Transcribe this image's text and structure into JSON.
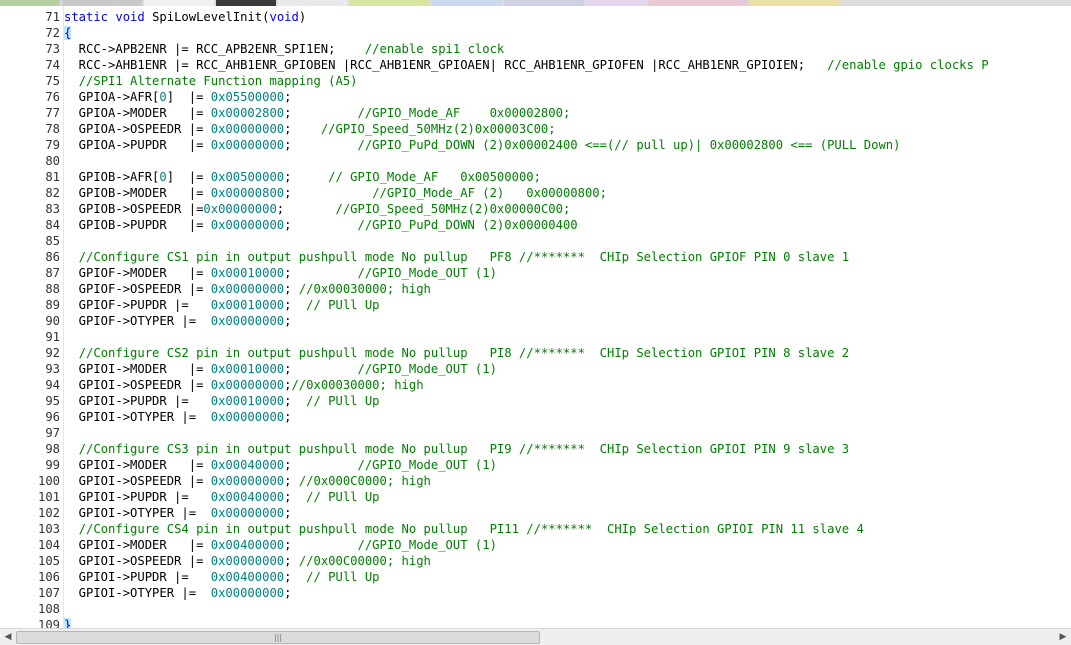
{
  "tab_colors": [
    "#b5d1a2",
    "#c9c9c9",
    "#f0f0f0",
    "#3a3a3a",
    "#e9e9e9",
    "#d6e6a0",
    "#cbd9ef",
    "#cfcfe6",
    "#e6d6f0",
    "#eac9d6",
    "#ebe1a8"
  ],
  "icons": {
    "scroll_left": "left-arrow-icon",
    "scroll_right": "right-arrow-icon",
    "grip": "grip-icon"
  },
  "lines": [
    {
      "n": "71",
      "segs": [
        {
          "t": "static",
          "c": "kw"
        },
        {
          "t": " "
        },
        {
          "t": "void",
          "c": "kw"
        },
        {
          "t": " SpiLowLevelInit("
        },
        {
          "t": "void",
          "c": "kw"
        },
        {
          "t": ")"
        }
      ]
    },
    {
      "n": "72",
      "segs": [
        {
          "t": "{",
          "c": "brace"
        }
      ]
    },
    {
      "n": "73",
      "segs": [
        {
          "t": "  RCC->APB2ENR |= RCC_APB2ENR_SPI1EN;    "
        },
        {
          "t": "//enable spi1 clock",
          "c": "cm"
        }
      ]
    },
    {
      "n": "74",
      "segs": [
        {
          "t": "  RCC->AHB1ENR |= RCC_AHB1ENR_GPIOBEN |RCC_AHB1ENR_GPIOAEN| RCC_AHB1ENR_GPIOFEN |RCC_AHB1ENR_GPIOIEN;   "
        },
        {
          "t": "//enable gpio clocks P",
          "c": "cm"
        }
      ]
    },
    {
      "n": "75",
      "segs": [
        {
          "t": "  "
        },
        {
          "t": "//SPI1 Alternate Function mapping (A5)",
          "c": "cm"
        }
      ]
    },
    {
      "n": "76",
      "segs": [
        {
          "t": "  GPIOA->AFR["
        },
        {
          "t": "0",
          "c": "num"
        },
        {
          "t": "]  |= "
        },
        {
          "t": "0x05500000",
          "c": "num"
        },
        {
          "t": ";"
        }
      ]
    },
    {
      "n": "77",
      "segs": [
        {
          "t": "  GPIOA->MODER   |= "
        },
        {
          "t": "0x00002800",
          "c": "num"
        },
        {
          "t": ";         "
        },
        {
          "t": "//GPIO_Mode_AF    0x00002800;",
          "c": "cm"
        }
      ]
    },
    {
      "n": "78",
      "segs": [
        {
          "t": "  GPIOA->OSPEEDR |= "
        },
        {
          "t": "0x00000000",
          "c": "num"
        },
        {
          "t": ";    "
        },
        {
          "t": "//GPIO_Speed_50MHz(2)0x00003C00;",
          "c": "cm"
        }
      ]
    },
    {
      "n": "79",
      "segs": [
        {
          "t": "  GPIOA->PUPDR   |= "
        },
        {
          "t": "0x00000000",
          "c": "num"
        },
        {
          "t": ";         "
        },
        {
          "t": "//GPIO_PuPd_DOWN (2)0x00002400 <==(// pull up)| 0x00002800 <== (PULL Down)",
          "c": "cm"
        }
      ]
    },
    {
      "n": "80",
      "segs": []
    },
    {
      "n": "81",
      "segs": [
        {
          "t": "  GPIOB->AFR["
        },
        {
          "t": "0",
          "c": "num"
        },
        {
          "t": "]  |= "
        },
        {
          "t": "0x00500000",
          "c": "num"
        },
        {
          "t": ";     "
        },
        {
          "t": "// GPIO_Mode_AF   0x00500000;",
          "c": "cm"
        }
      ]
    },
    {
      "n": "82",
      "segs": [
        {
          "t": "  GPIOB->MODER   |= "
        },
        {
          "t": "0x00000800",
          "c": "num"
        },
        {
          "t": ";           "
        },
        {
          "t": "//GPIO_Mode_AF (2)   0x00000800;",
          "c": "cm"
        }
      ]
    },
    {
      "n": "83",
      "segs": [
        {
          "t": "  GPIOB->OSPEEDR |="
        },
        {
          "t": "0x00000000",
          "c": "num"
        },
        {
          "t": ";       "
        },
        {
          "t": "//GPIO_Speed_50MHz(2)0x00000C00;",
          "c": "cm"
        }
      ]
    },
    {
      "n": "84",
      "segs": [
        {
          "t": "  GPIOB->PUPDR   |= "
        },
        {
          "t": "0x00000000",
          "c": "num"
        },
        {
          "t": ";         "
        },
        {
          "t": "//GPIO_PuPd_DOWN (2)0x00000400",
          "c": "cm"
        }
      ]
    },
    {
      "n": "85",
      "segs": []
    },
    {
      "n": "86",
      "segs": [
        {
          "t": "  "
        },
        {
          "t": "//Configure CS1 pin in output pushpull mode No pullup   PF8 //*******  CHIp Selection GPIOF PIN 0 slave 1",
          "c": "cm"
        }
      ]
    },
    {
      "n": "87",
      "segs": [
        {
          "t": "  GPIOF->MODER   |= "
        },
        {
          "t": "0x00010000",
          "c": "num"
        },
        {
          "t": ";         "
        },
        {
          "t": "//GPIO_Mode_OUT (1)",
          "c": "cm"
        }
      ]
    },
    {
      "n": "88",
      "segs": [
        {
          "t": "  GPIOF->OSPEEDR |= "
        },
        {
          "t": "0x00000000",
          "c": "num"
        },
        {
          "t": "; "
        },
        {
          "t": "//0x00030000; high",
          "c": "cm"
        }
      ]
    },
    {
      "n": "89",
      "segs": [
        {
          "t": "  GPIOF->PUPDR |=   "
        },
        {
          "t": "0x00010000",
          "c": "num"
        },
        {
          "t": ";  "
        },
        {
          "t": "// PUll Up",
          "c": "cm"
        }
      ]
    },
    {
      "n": "90",
      "segs": [
        {
          "t": "  GPIOF->OTYPER |=  "
        },
        {
          "t": "0x00000000",
          "c": "num"
        },
        {
          "t": ";"
        }
      ]
    },
    {
      "n": "91",
      "segs": []
    },
    {
      "n": "92",
      "segs": [
        {
          "t": "  "
        },
        {
          "t": "//Configure CS2 pin in output pushpull mode No pullup   PI8 //*******  CHIp Selection GPIOI PIN 8 slave 2",
          "c": "cm"
        }
      ]
    },
    {
      "n": "93",
      "segs": [
        {
          "t": "  GPIOI->MODER   |= "
        },
        {
          "t": "0x00010000",
          "c": "num"
        },
        {
          "t": ";         "
        },
        {
          "t": "//GPIO_Mode_OUT (1)",
          "c": "cm"
        }
      ]
    },
    {
      "n": "94",
      "segs": [
        {
          "t": "  GPIOI->OSPEEDR |= "
        },
        {
          "t": "0x00000000",
          "c": "num"
        },
        {
          "t": ";"
        },
        {
          "t": "//0x00030000; high",
          "c": "cm"
        }
      ]
    },
    {
      "n": "95",
      "segs": [
        {
          "t": "  GPIOI->PUPDR |=   "
        },
        {
          "t": "0x00010000",
          "c": "num"
        },
        {
          "t": ";  "
        },
        {
          "t": "// PUll Up",
          "c": "cm"
        }
      ]
    },
    {
      "n": "96",
      "segs": [
        {
          "t": "  GPIOI->OTYPER |=  "
        },
        {
          "t": "0x00000000",
          "c": "num"
        },
        {
          "t": ";"
        }
      ]
    },
    {
      "n": "97",
      "segs": []
    },
    {
      "n": "98",
      "segs": [
        {
          "t": "  "
        },
        {
          "t": "//Configure CS3 pin in output pushpull mode No pullup   PI9 //*******  CHIp Selection GPIOI PIN 9 slave 3",
          "c": "cm"
        }
      ]
    },
    {
      "n": "99",
      "segs": [
        {
          "t": "  GPIOI->MODER   |= "
        },
        {
          "t": "0x00040000",
          "c": "num"
        },
        {
          "t": ";         "
        },
        {
          "t": "//GPIO_Mode_OUT (1)",
          "c": "cm"
        }
      ]
    },
    {
      "n": "100",
      "segs": [
        {
          "t": "  GPIOI->OSPEEDR |= "
        },
        {
          "t": "0x00000000",
          "c": "num"
        },
        {
          "t": "; "
        },
        {
          "t": "//0x000C0000; high",
          "c": "cm"
        }
      ]
    },
    {
      "n": "101",
      "segs": [
        {
          "t": "  GPIOI->PUPDR |=   "
        },
        {
          "t": "0x00040000",
          "c": "num"
        },
        {
          "t": ";  "
        },
        {
          "t": "// PUll Up",
          "c": "cm"
        }
      ]
    },
    {
      "n": "102",
      "segs": [
        {
          "t": "  GPIOI->OTYPER |=  "
        },
        {
          "t": "0x00000000",
          "c": "num"
        },
        {
          "t": ";"
        }
      ]
    },
    {
      "n": "103",
      "segs": [
        {
          "t": "  "
        },
        {
          "t": "//Configure CS4 pin in output pushpull mode No pullup   PI11 //*******  CHIp Selection GPIOI PIN 11 slave 4",
          "c": "cm"
        }
      ]
    },
    {
      "n": "104",
      "segs": [
        {
          "t": "  GPIOI->MODER   |= "
        },
        {
          "t": "0x00400000",
          "c": "num"
        },
        {
          "t": ";         "
        },
        {
          "t": "//GPIO_Mode_OUT (1)",
          "c": "cm"
        }
      ]
    },
    {
      "n": "105",
      "segs": [
        {
          "t": "  GPIOI->OSPEEDR |= "
        },
        {
          "t": "0x00000000",
          "c": "num"
        },
        {
          "t": "; "
        },
        {
          "t": "//0x00C00000; high",
          "c": "cm"
        }
      ]
    },
    {
      "n": "106",
      "segs": [
        {
          "t": "  GPIOI->PUPDR |=   "
        },
        {
          "t": "0x00400000",
          "c": "num"
        },
        {
          "t": ";  "
        },
        {
          "t": "// PUll Up",
          "c": "cm"
        }
      ]
    },
    {
      "n": "107",
      "segs": [
        {
          "t": "  GPIOI->OTYPER |=  "
        },
        {
          "t": "0x00000000",
          "c": "num"
        },
        {
          "t": ";"
        }
      ]
    },
    {
      "n": "108",
      "segs": []
    },
    {
      "n": "109",
      "segs": [
        {
          "t": "}",
          "c": "brace"
        }
      ]
    }
  ]
}
